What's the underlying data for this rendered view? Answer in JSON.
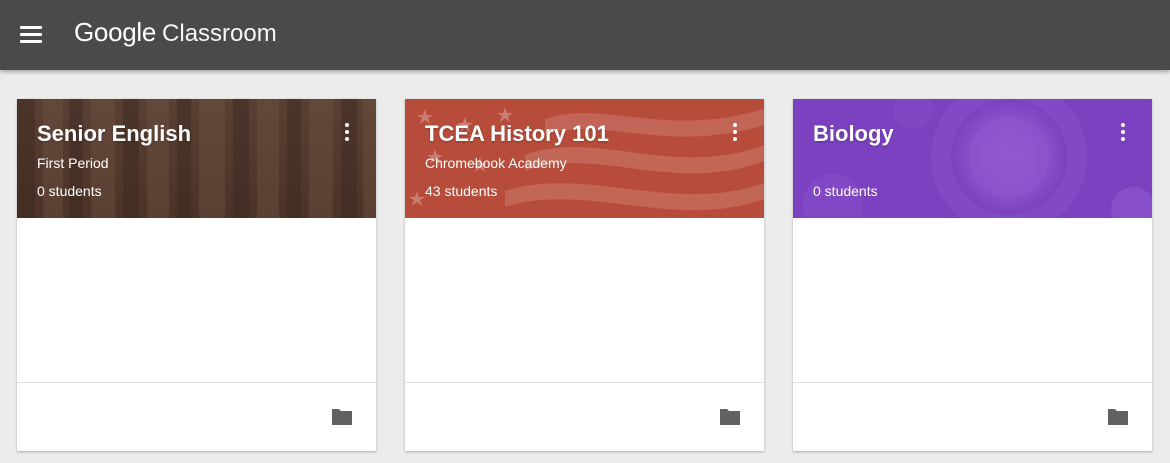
{
  "header": {
    "brand_google": "Google",
    "brand_product": "Classroom",
    "menu_icon": "hamburger-menu-icon",
    "background": "#4a4a4a"
  },
  "classes": [
    {
      "title": "Senior English",
      "section": "First Period",
      "students": "0 students",
      "theme": "books",
      "color": "#6b4a3a",
      "more_icon": "more-vert-icon",
      "folder_icon": "folder-icon"
    },
    {
      "title": "TCEA History 101",
      "section": "Chromebook Academy",
      "students": "43 students",
      "theme": "flag",
      "color": "#c2513e",
      "more_icon": "more-vert-icon",
      "folder_icon": "folder-icon"
    },
    {
      "title": "Biology",
      "section": "",
      "students": "0 students",
      "theme": "cells",
      "color": "#7a3fbf",
      "more_icon": "more-vert-icon",
      "folder_icon": "folder-icon"
    }
  ]
}
